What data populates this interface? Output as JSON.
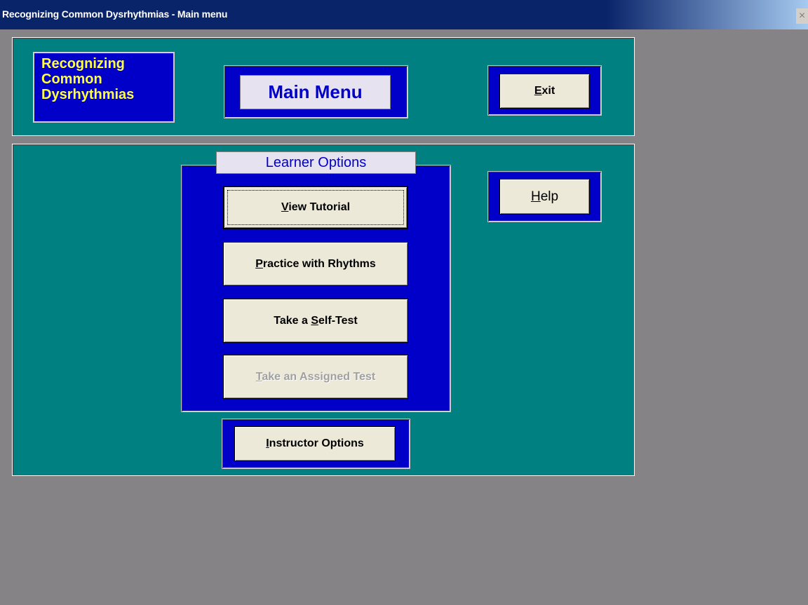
{
  "window": {
    "title": "Recognizing Common Dysrhythmias - Main menu",
    "close_glyph": "×"
  },
  "logo": {
    "line1": "Recognizing",
    "line2": "Common",
    "line3": "Dysrhythmias"
  },
  "header": {
    "main_menu_label": "Main Menu",
    "exit_pre": "",
    "exit_key": "E",
    "exit_post": "xit"
  },
  "learner": {
    "title": "Learner Options",
    "view_tutorial": {
      "pre": "",
      "key": "V",
      "post": "iew Tutorial"
    },
    "practice": {
      "pre": "",
      "key": "P",
      "post": "ractice with Rhythms"
    },
    "self_test": {
      "pre": "Take a ",
      "key": "S",
      "post": "elf-Test"
    },
    "assigned_test": {
      "pre": "",
      "key": "T",
      "post": "ake an Assigned Test"
    }
  },
  "help": {
    "pre": "",
    "key": "H",
    "post": "elp"
  },
  "instructor": {
    "pre": "",
    "key": "I",
    "post": "nstructor Options"
  },
  "colors": {
    "teal": "#008080",
    "blue": "#0000c8",
    "logo_text": "#ffff40",
    "desktop_gray": "#858385"
  }
}
